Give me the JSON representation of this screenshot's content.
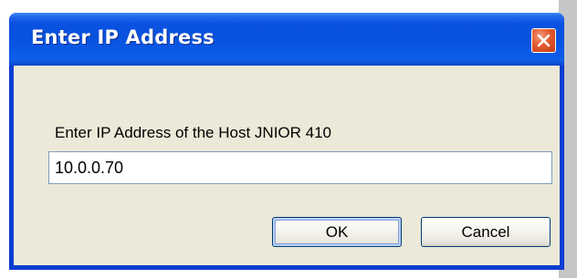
{
  "window": {
    "title": "Enter IP Address"
  },
  "dialog": {
    "prompt": "Enter IP Address of the Host JNIOR 410",
    "ip_value": "10.0.0.70",
    "ok_label": "OK",
    "cancel_label": "Cancel"
  },
  "icons": {
    "close": "close-icon"
  },
  "colors": {
    "titlebar": "#0853de",
    "client_background": "#ece9d8",
    "close_button": "#e25a30"
  }
}
